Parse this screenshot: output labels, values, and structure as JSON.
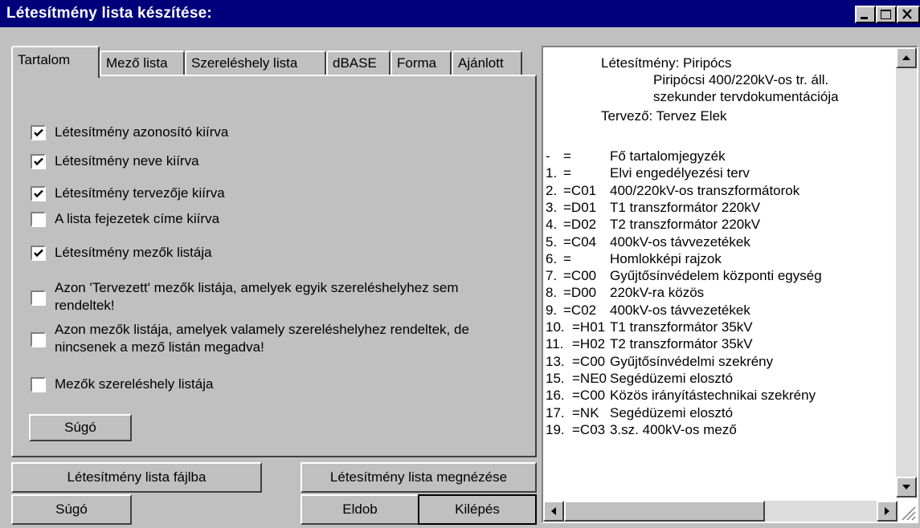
{
  "window": {
    "title": "Létesítmény lista készítése:"
  },
  "tabs": [
    "Tartalom",
    "Mező lista",
    "Szereléshely lista",
    "dBASE",
    "Forma",
    "Ajánlott"
  ],
  "options": [
    {
      "label": "Létesítmény azonosító kiírva",
      "checked": true
    },
    {
      "label": "Létesítmény neve kiírva",
      "checked": true
    },
    {
      "label": "Létesítmény tervezője kiírva",
      "checked": true
    },
    {
      "label": "A lista fejezetek címe kiírva",
      "checked": false
    },
    {
      "label": "Létesítmény mezők listája",
      "checked": true
    },
    {
      "label_line1": "Azon 'Tervezett' mezők listája, amelyek egyik szereléshelyhez sem",
      "label_line2": "rendeltek!",
      "checked": false
    },
    {
      "label_line1": "Azon mezők listája, amelyek valamely szereléshelyhez rendeltek, de",
      "label_line2": "nincsenek a mező listán megadva!",
      "checked": false
    },
    {
      "label": "Mezők szereléshely listája",
      "checked": false
    }
  ],
  "buttons": {
    "panel_help": "Súgó",
    "to_file": "Létesítmény lista fájlba",
    "preview": "Létesítmény lista megnézése",
    "help": "Súgó",
    "discard": "Eldob",
    "exit": "Kilépés"
  },
  "preview": {
    "line1": "Létesítmény: Piripócs",
    "line2": "Piripócsi 400/220kV-os tr. áll.",
    "line3": "szekunder tervdokumentációja",
    "line4": "Tervező: Tervez Elek",
    "rows": [
      {
        "num": "-",
        "code": "=",
        "text": "Fő tartalomjegyzék"
      },
      {
        "num": "1.",
        "code": "=",
        "text": "Elvi engedélyezési terv"
      },
      {
        "num": "2.",
        "code": "=C01",
        "text": "400/220kV-os transzformátorok"
      },
      {
        "num": "3.",
        "code": "=D01",
        "text": "T1 transzformátor 220kV"
      },
      {
        "num": "4.",
        "code": "=D02",
        "text": "T2 transzformátor 220kV"
      },
      {
        "num": "5.",
        "code": "=C04",
        "text": "400kV-os távvezetékek"
      },
      {
        "num": "6.",
        "code": "=",
        "text": "Homlokképi rajzok"
      },
      {
        "num": "7.",
        "code": "=C00",
        "text": "Gyűjtősínvédelem  központi egység"
      },
      {
        "num": "8.",
        "code": "=D00",
        "text": "220kV-ra közös"
      },
      {
        "num": "9.",
        "code": "=C02",
        "text": "400kV-os távvezetékek"
      },
      {
        "num": "10.",
        "code": "=H01",
        "text": "T1 transzformátor 35kV"
      },
      {
        "num": "11.",
        "code": "=H02",
        "text": "T2 transzformátor 35kV"
      },
      {
        "num": "13.",
        "code": "=C00",
        "text": "Gyűjtősínvédelmi szekrény"
      },
      {
        "num": "15.",
        "code": "=NE0",
        "text": "Segédüzemi elosztó"
      },
      {
        "num": "16.",
        "code": "=C00",
        "text": "Közös irányítástechnikai szekrény"
      },
      {
        "num": "17.",
        "code": "=NK",
        "text": "Segédüzemi elosztó"
      },
      {
        "num": "19.",
        "code": "=C03",
        "text": "3.sz. 400kV-os mező"
      }
    ]
  }
}
